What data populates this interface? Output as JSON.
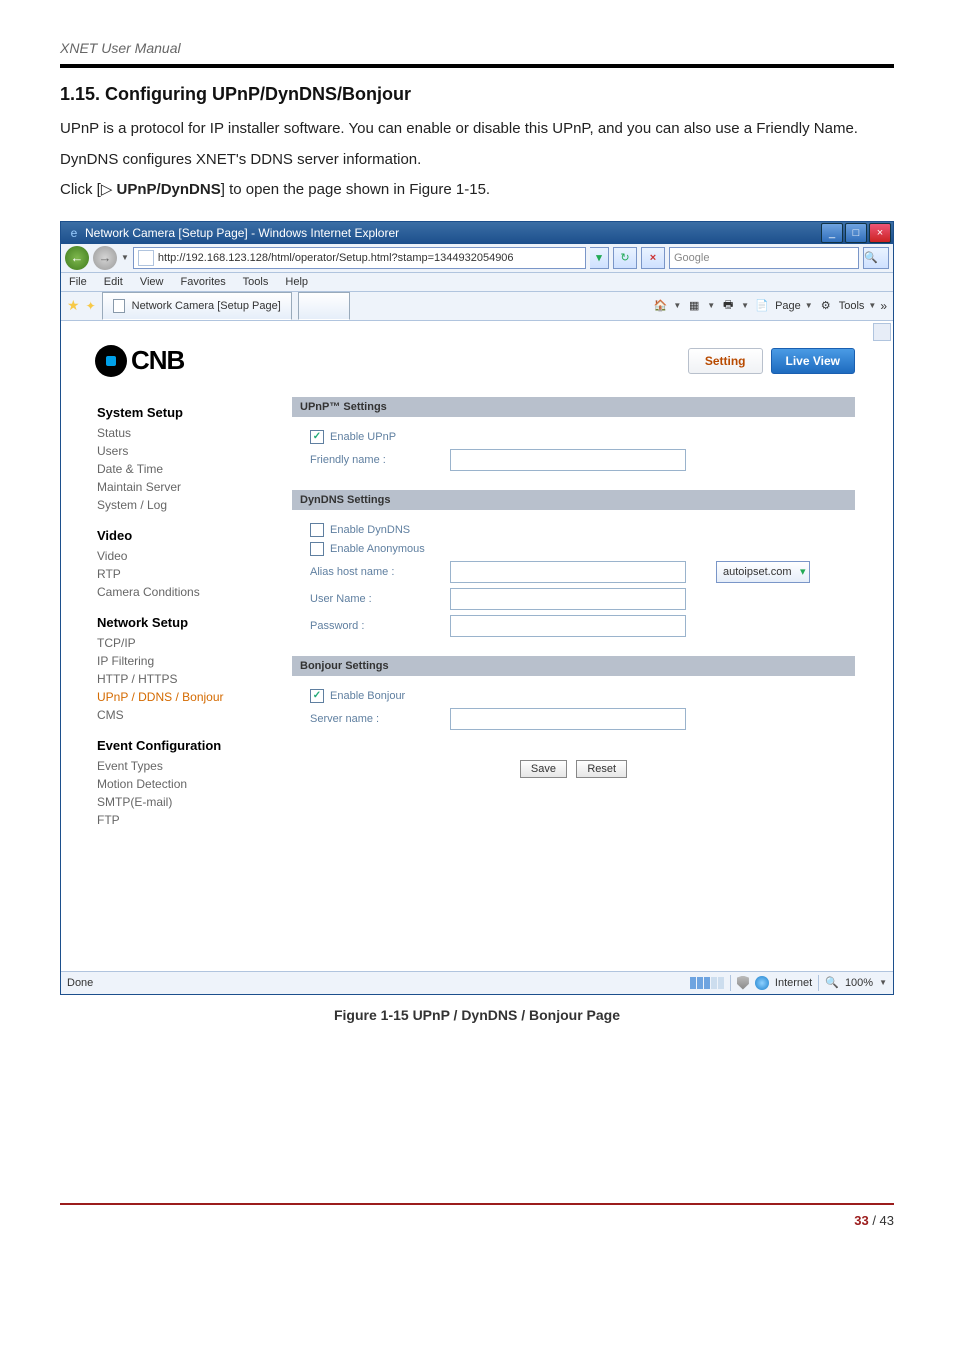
{
  "doc": {
    "header": "XNET User Manual",
    "section_title": "1.15. Configuring UPnP/DynDNS/Bonjour",
    "para1": "UPnP is a protocol for IP installer software. You can enable or disable this UPnP, and you can also use a Friendly Name.",
    "para2": "DynDNS configures XNET's DDNS server information.",
    "para3a": "Click [▷ ",
    "para3b": "UPnP/DynDNS",
    "para3c": "] to open the page shown in Figure 1-15.",
    "figure_caption": "Figure 1-15 UPnP / DynDNS / Bonjour Page",
    "page_num_bold": "33",
    "page_num_rest": " / 43"
  },
  "ie": {
    "title": "Network Camera [Setup Page] - Windows Internet Explorer",
    "url": "http://192.168.123.128/html/operator/Setup.html?stamp=1344932054906",
    "search_placeholder": "Google",
    "menus": {
      "file": "File",
      "edit": "Edit",
      "view": "View",
      "fav": "Favorites",
      "tools": "Tools",
      "help": "Help"
    },
    "tab_label": "Network Camera [Setup Page]",
    "tool_page": "Page",
    "tool_tools": "Tools",
    "status_done": "Done",
    "status_zone": "Internet",
    "status_zoom": "100%"
  },
  "page": {
    "logo_text": "CNB",
    "btn_setting": "Setting",
    "btn_live": "Live View",
    "sidebar": {
      "g1": "System Setup",
      "g1_items": [
        "Status",
        "Users",
        "Date & Time",
        "Maintain Server",
        "System / Log"
      ],
      "g2": "Video",
      "g2_items": [
        "Video",
        "RTP",
        "Camera Conditions"
      ],
      "g3": "Network Setup",
      "g3_items": [
        "TCP/IP",
        "IP Filtering",
        "HTTP / HTTPS",
        "UPnP / DDNS / Bonjour",
        "CMS"
      ],
      "g4": "Event Configuration",
      "g4_items": [
        "Event Types",
        "Motion Detection",
        "SMTP(E-mail)",
        "FTP"
      ]
    },
    "upnp": {
      "hdr": "UPnP™ Settings",
      "enable": "Enable UPnP",
      "friendly": "Friendly name :"
    },
    "dyndns": {
      "hdr": "DynDNS Settings",
      "enable": "Enable DynDNS",
      "anon": "Enable Anonymous",
      "alias": "Alias host name :",
      "domain": "autoipset.com",
      "user": "User Name :",
      "pass": "Password :"
    },
    "bonjour": {
      "hdr": "Bonjour Settings",
      "enable": "Enable Bonjour",
      "server": "Server name :"
    },
    "btn_save": "Save",
    "btn_reset": "Reset"
  }
}
